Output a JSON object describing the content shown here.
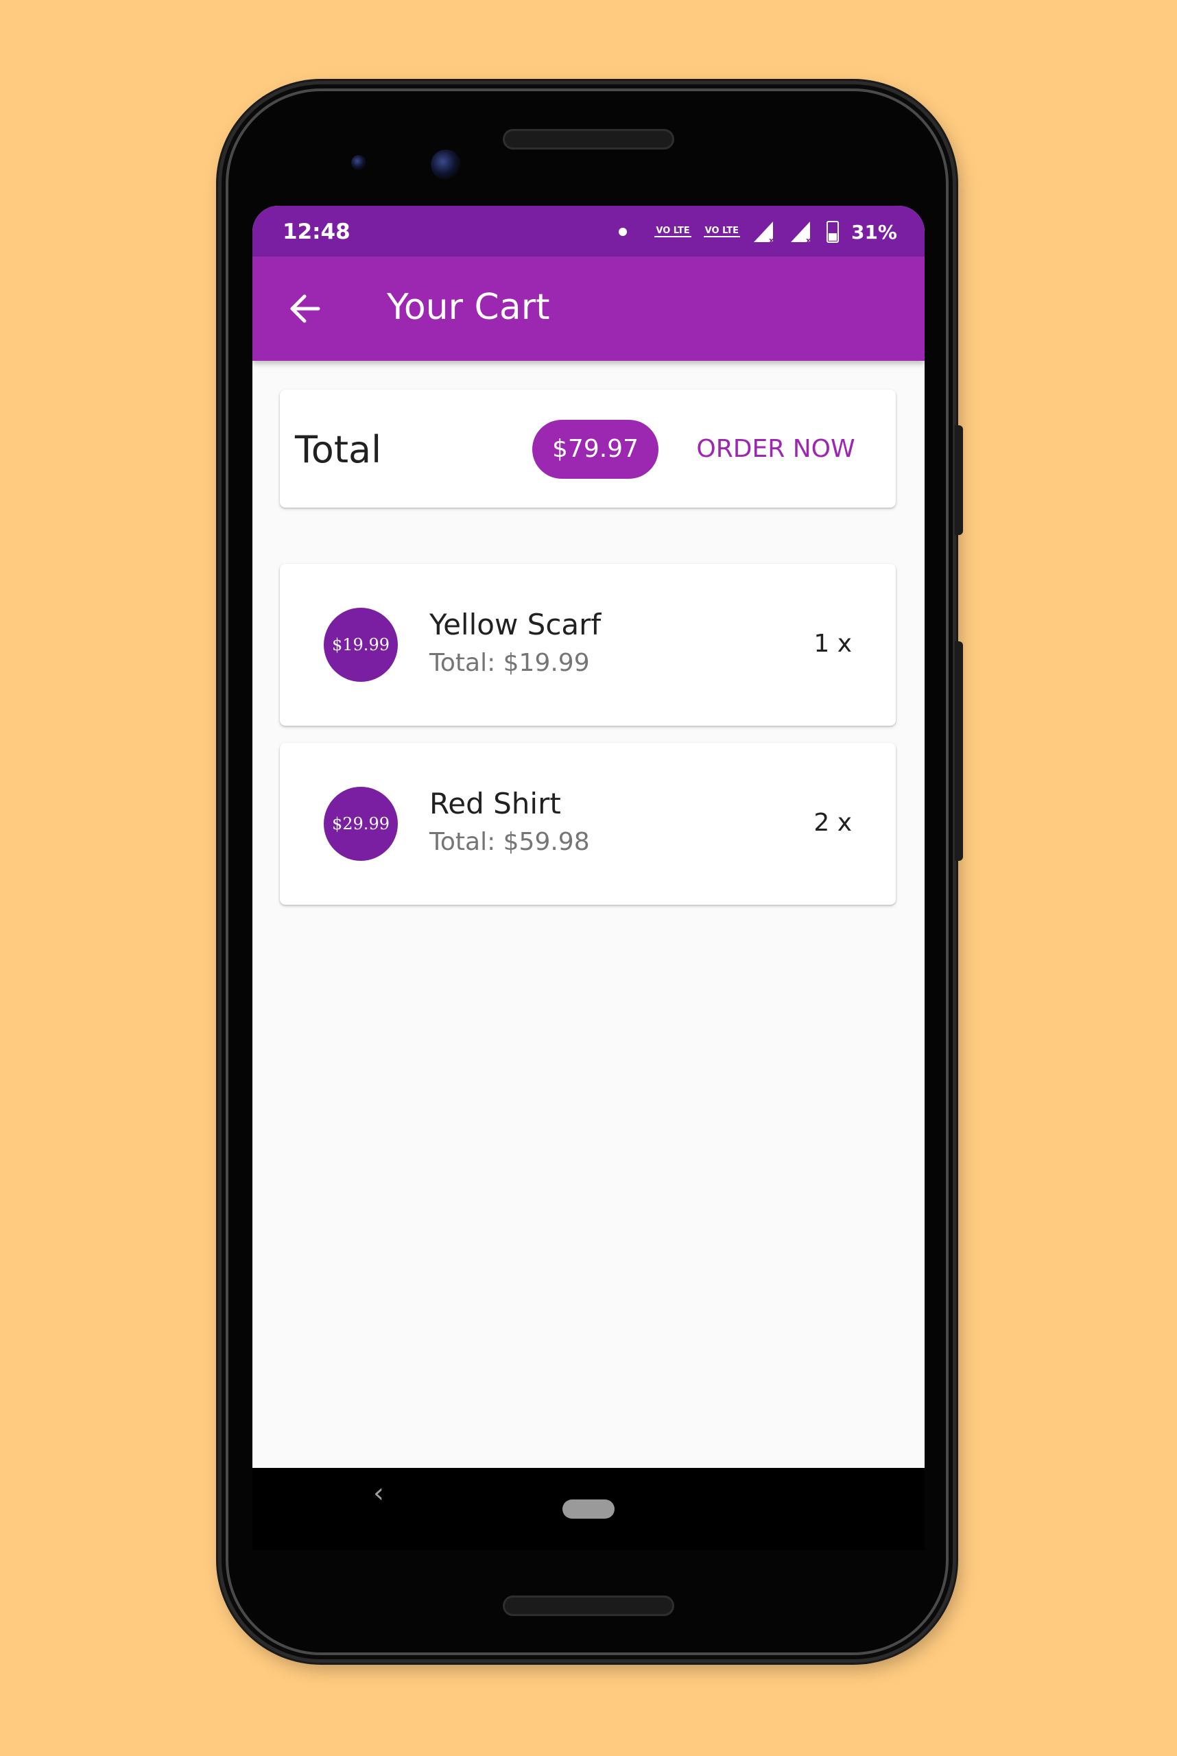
{
  "status_bar": {
    "time": "12:48",
    "volte1": "VO LTE",
    "volte2": "VO LTE",
    "battery": "31%"
  },
  "app_bar": {
    "title": "Your Cart",
    "back_icon": "arrow-back-icon"
  },
  "summary": {
    "label": "Total",
    "amount": "$79.97",
    "order_button": "ORDER NOW"
  },
  "items": [
    {
      "price": "$19.99",
      "name": "Yellow Scarf",
      "total": "Total: $19.99",
      "qty": "1 x"
    },
    {
      "price": "$29.99",
      "name": "Red Shirt",
      "total": "Total: $59.98",
      "qty": "2 x"
    }
  ],
  "nav": {
    "back_glyph": "‹",
    "home_icon": "home-pill-icon"
  },
  "colors": {
    "background": "#FFCB80",
    "primary": "#9C27B0",
    "primary_dark": "#7B1FA2"
  }
}
